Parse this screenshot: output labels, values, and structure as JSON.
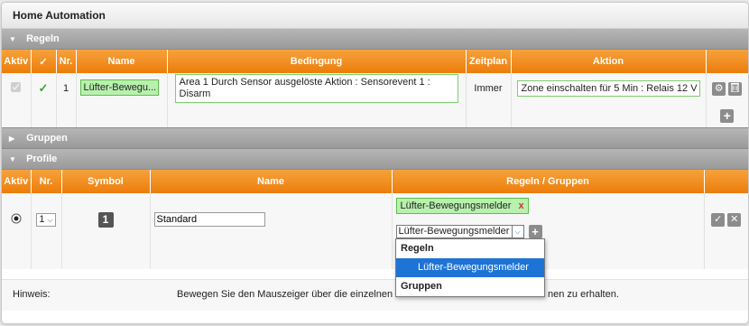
{
  "app": {
    "title": "Home Automation"
  },
  "sections": {
    "regeln": "Regeln",
    "gruppen": "Gruppen",
    "profile": "Profile"
  },
  "regeln_table": {
    "headers": [
      "Aktiv",
      "✓",
      "Nr.",
      "Name",
      "Bedingung",
      "Zeitplan",
      "Aktion"
    ],
    "row": {
      "nr": "1",
      "name": "Lüfter-Bewegu...",
      "bedingung": "Area 1 Durch Sensor ausgelöste Aktion : Sensorevent 1 : Disarm",
      "zeitplan": "Immer",
      "aktion": "Zone einschalten für 5 Min : Relais 12 V"
    }
  },
  "profile_table": {
    "headers": [
      "Aktiv",
      "Nr.",
      "Symbol",
      "Name",
      "Regeln / Gruppen"
    ],
    "row": {
      "nr": "1",
      "symbol": "1",
      "name_value": "Standard",
      "tag": "Lüfter-Bewegungsmelder",
      "tag_remove": "x",
      "select_value": "Lüfter-Bewegungsmelder"
    }
  },
  "dropdown": {
    "group1": "Regeln",
    "option1": "Lüfter-Bewegungsmelder",
    "group2": "Gruppen"
  },
  "hint": {
    "label": "Hinweis:",
    "text_start": "Bewegen Sie den Mauszeiger über die einzelnen El",
    "text_end": "nen zu erhalten."
  },
  "icons": {
    "settings": "gear-icon",
    "delete": "trash-icon",
    "add": "plus-icon",
    "confirm": "check-icon",
    "cancel": "close-icon"
  },
  "colors": {
    "header_orange": "#ef8a18",
    "section_gray": "#a6a6a6",
    "tag_green": "#b8f0ae",
    "selected_blue": "#1e73d6"
  }
}
